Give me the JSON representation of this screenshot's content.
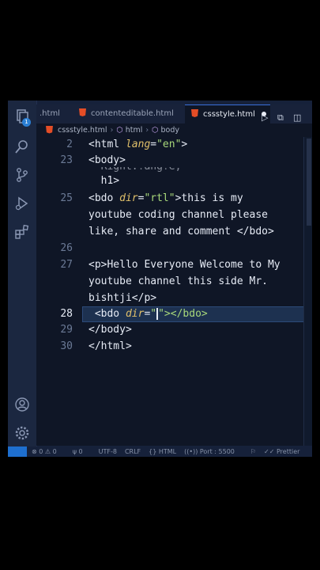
{
  "tabs": [
    {
      "label": ".html",
      "active": false
    },
    {
      "label": "contenteditable.html",
      "active": false
    },
    {
      "label": "cssstyle.html",
      "active": true
    }
  ],
  "activity": {
    "badge_count": "1"
  },
  "breadcrumb": {
    "file": "cssstyle.html",
    "item1": "html",
    "item2": "body"
  },
  "gutter": [
    "2",
    "23",
    "",
    "25",
    "",
    "",
    "26",
    "27",
    "",
    "",
    "28",
    "29",
    "30"
  ],
  "code_lines": {
    "l2a": "<html ",
    "l2b": "lang",
    "l2c": "=",
    "l2d": "\"en\"",
    "l2e": ">",
    "l23": "<body>",
    "l24_partial": "  h1>",
    "l25a": "<bdo ",
    "l25b": "dir",
    "l25c": "=",
    "l25d": "\"rtl\"",
    "l25e": ">this is my",
    "l25f": "youtube coding channel please",
    "l25g": "like, share and comment </bdo>",
    "l27a": "<p>Hello Everyone Welcome to My",
    "l27b": "youtube channel this side Mr.",
    "l27c": "bishtji</p>",
    "l28a": " <bdo ",
    "l28b": "dir",
    "l28c": "=",
    "l28d": "\"",
    "l28e": "\"></bdo>",
    "l29": "</body>",
    "l30": "</html>"
  },
  "status": {
    "problems": "0 ⚠ 0",
    "info": "0",
    "encoding": "UTF-8",
    "eol": "CRLF",
    "language": "{} HTML",
    "port": "Port : 5500",
    "formatter": "Prettier"
  },
  "colors": {
    "accent": "#1e6fcf",
    "html_icon": "#e44d26",
    "string": "#a8d87a",
    "attribute": "#e0c06a"
  }
}
